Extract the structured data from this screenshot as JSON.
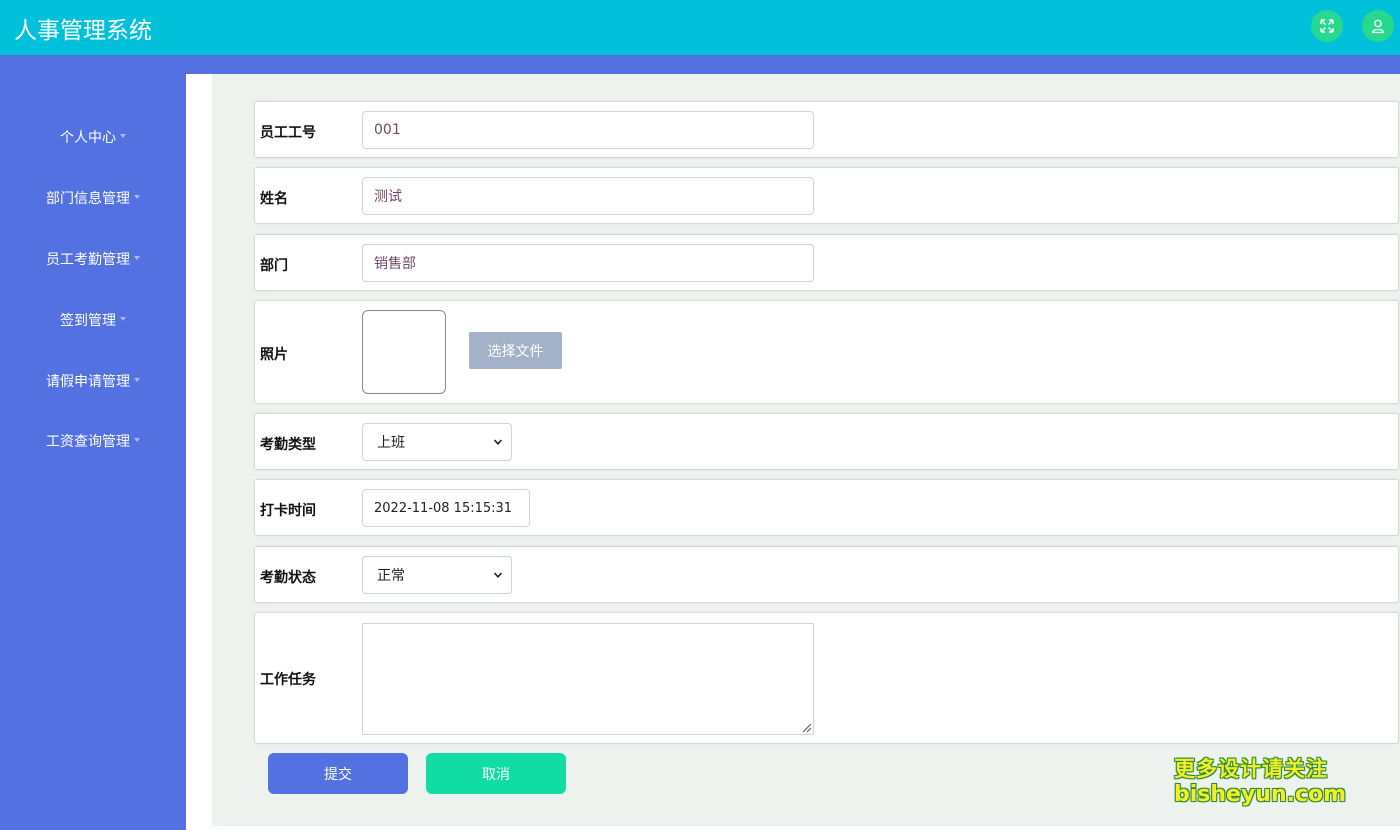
{
  "header": {
    "title": "人事管理系统",
    "fullscreen_icon": "expand-icon",
    "user_icon": "user-icon",
    "accent": "#00c1d9"
  },
  "sidebar": {
    "color": "#5371e0",
    "items": [
      {
        "label": "个人中心"
      },
      {
        "label": "部门信息管理"
      },
      {
        "label": "员工考勤管理"
      },
      {
        "label": "签到管理"
      },
      {
        "label": "请假申请管理"
      },
      {
        "label": "工资查询管理"
      }
    ]
  },
  "form": {
    "employee_id": {
      "label": "员工工号",
      "value": "001"
    },
    "name": {
      "label": "姓名",
      "value": "测试"
    },
    "department": {
      "label": "部门",
      "value": "销售部"
    },
    "photo": {
      "label": "照片",
      "button": "选择文件"
    },
    "attendance_type": {
      "label": "考勤类型",
      "value": "上班"
    },
    "clock_time": {
      "label": "打卡时间",
      "value": "2022-11-08 15:15:31"
    },
    "attendance_status": {
      "label": "考勤状态",
      "value": "正常"
    },
    "task": {
      "label": "工作任务",
      "value": ""
    }
  },
  "actions": {
    "submit": "提交",
    "cancel": "取消"
  },
  "watermark": {
    "line1": "更多设计请关注",
    "line2": "bisheyun.com"
  }
}
